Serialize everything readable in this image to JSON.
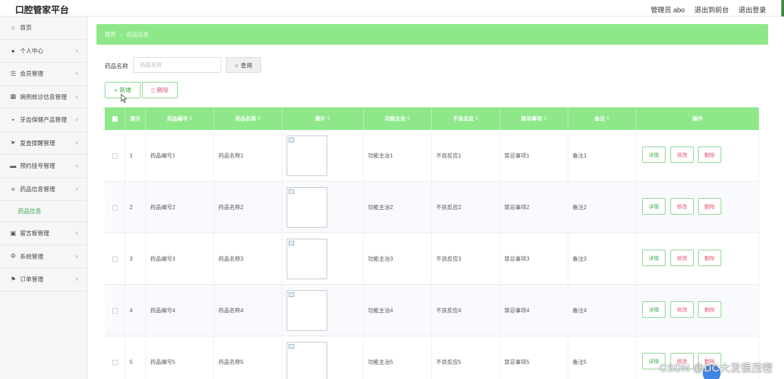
{
  "header": {
    "app_title": "口腔管家平台",
    "admin_label": "管理员 abo",
    "frontend_link": "退出到前台",
    "logout_link": "退出登录"
  },
  "sidebar": {
    "items": [
      {
        "label": "首页",
        "icon": "home-icon",
        "glyph": "⌂",
        "chevron": false
      },
      {
        "label": "个人中心",
        "icon": "user-icon",
        "glyph": "●",
        "chevron": true
      },
      {
        "label": "会员管理",
        "icon": "members-icon",
        "glyph": "☰",
        "chevron": true
      },
      {
        "label": "病例就诊信息管理",
        "icon": "grid-icon",
        "glyph": "▦",
        "chevron": true
      },
      {
        "label": "牙齿保健产品管理",
        "icon": "apps-icon",
        "glyph": "▪",
        "chevron": true
      },
      {
        "label": "复查提醒管理",
        "icon": "send-icon",
        "glyph": "➤",
        "chevron": true
      },
      {
        "label": "预约挂号管理",
        "icon": "briefcase-icon",
        "glyph": "▬",
        "chevron": true
      },
      {
        "label": "药品信息管理",
        "icon": "list-icon",
        "glyph": "≡",
        "chevron": true,
        "expanded": true
      },
      {
        "label": "留言板管理",
        "icon": "board-icon",
        "glyph": "▣",
        "chevron": true
      },
      {
        "label": "系统管理",
        "icon": "settings-icon",
        "glyph": "⚙",
        "chevron": true
      },
      {
        "label": "订单管理",
        "icon": "flag-icon",
        "glyph": "⚑",
        "chevron": true
      }
    ],
    "sub_item": "药品信息"
  },
  "breadcrumb": {
    "home": "首页",
    "separator": "→",
    "current": "药品信息"
  },
  "search": {
    "label": "药品名称",
    "placeholder": "药品名称",
    "value": "",
    "button_label": "查询"
  },
  "toolbar": {
    "add_label": "新增",
    "delete_label": "删除"
  },
  "table": {
    "columns": [
      "索引",
      "药品编号",
      "药品名称",
      "图片",
      "功能主治",
      "不良反应",
      "禁忌事项",
      "备注",
      "操作"
    ],
    "actions": {
      "detail": "详情",
      "edit": "修改",
      "delete": "删除"
    },
    "rows": [
      {
        "index": "1",
        "code": "药品编号1",
        "name": "药品名称1",
        "function": "功能主治1",
        "adverse": "不良反应1",
        "contra": "禁忌事项1",
        "remark": "备注1"
      },
      {
        "index": "2",
        "code": "药品编号2",
        "name": "药品名称2",
        "function": "功能主治2",
        "adverse": "不良反应2",
        "contra": "禁忌事项2",
        "remark": "备注2"
      },
      {
        "index": "3",
        "code": "药品编号3",
        "name": "药品名称3",
        "function": "功能主治3",
        "adverse": "不良反应3",
        "contra": "禁忌事项3",
        "remark": "备注3"
      },
      {
        "index": "4",
        "code": "药品编号4",
        "name": "药品名称4",
        "function": "功能主治4",
        "adverse": "不良反应4",
        "contra": "禁忌事项4",
        "remark": "备注4"
      },
      {
        "index": "5",
        "code": "药品编号5",
        "name": "药品名称5",
        "function": "功能主治5",
        "adverse": "不良反应5",
        "contra": "禁忌事项5",
        "remark": "备注5"
      }
    ]
  },
  "watermark": "CSDN @DC大发很茂密",
  "colors": {
    "accent_green": "#8ee88a",
    "button_green": "#3aaa46",
    "danger_pink": "#e0566e"
  }
}
